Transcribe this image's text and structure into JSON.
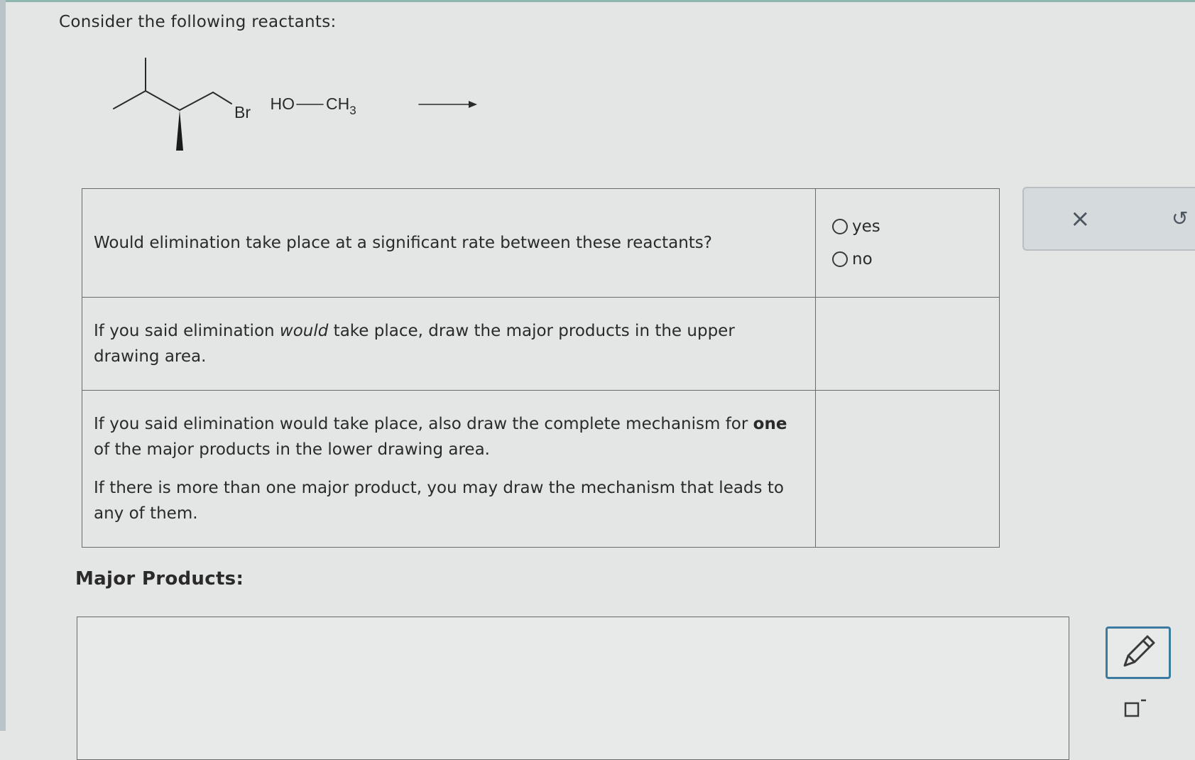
{
  "question": {
    "intro": "Consider the following reactants:",
    "reaction": {
      "substituent_label": "Br",
      "reagent_left": "HO",
      "reagent_right_main": "CH",
      "reagent_right_sub": "3"
    },
    "rows": [
      {
        "text": "Would elimination take place at a significant rate between these reactants?",
        "options": [
          "yes",
          "no"
        ]
      },
      {
        "text_before": "If you said elimination ",
        "text_em": "would",
        "text_after": " take place, draw the major products in the upper drawing area."
      },
      {
        "p1_before": "If you said elimination would take place, also draw the complete mechanism for ",
        "p1_bold": "one",
        "p1_after": " of the major products in the lower drawing area.",
        "p2": "If there is more than one major product, you may draw the mechanism that leads to any of them."
      }
    ]
  },
  "major_products_label": "Major Products:",
  "toolbar": {
    "close_icon": "×",
    "undo_icon": "↺",
    "pencil_icon": "pencil-icon",
    "eraser_icon": "eraser-icon"
  }
}
